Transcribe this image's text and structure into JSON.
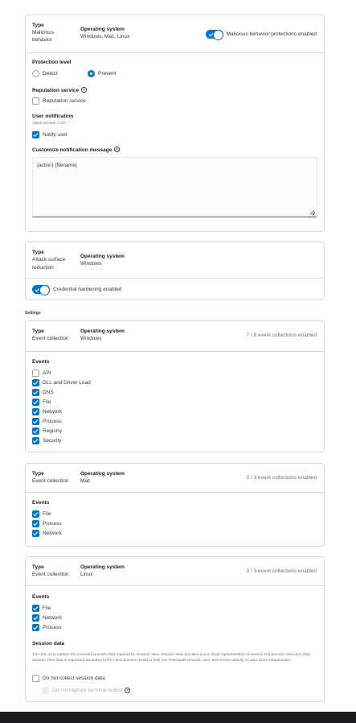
{
  "malicious": {
    "type_label": "Type",
    "type_value_1": "Malicious",
    "type_value_2": "behavior",
    "os_label": "Operating system",
    "os_value": "Windows, Mac, Linux",
    "toggle_label": "Malicious behavior protections enabled",
    "protection_level_label": "Protection level",
    "detect_label": "Detect",
    "prevent_label": "Prevent",
    "reputation_heading": "Reputation service",
    "reputation_checkbox": "Reputation service",
    "user_notification_heading": "User notification",
    "agent_version": "Agent version 7.15+",
    "notify_user_label": "Notify user",
    "customize_heading": "Customize notification message",
    "message_value": "{action} {filename}"
  },
  "attack_surface": {
    "type_label": "Type",
    "type_value_1": "Attack surface",
    "type_value_2": "reduction",
    "os_label": "Operating system",
    "os_value": "Windows",
    "toggle_label": "Credential hardening enabled"
  },
  "settings_label": "Settings",
  "windows_events": {
    "type_label": "Type",
    "type_value": "Event collection",
    "os_label": "Operating system",
    "os_value": "Windows",
    "status": "7 / 8 event collections enabled",
    "events_heading": "Events",
    "items": [
      {
        "label": "API",
        "checked": false
      },
      {
        "label": "DLL and Driver Load",
        "checked": true
      },
      {
        "label": "DNS",
        "checked": true
      },
      {
        "label": "File",
        "checked": true
      },
      {
        "label": "Network",
        "checked": true
      },
      {
        "label": "Process",
        "checked": true
      },
      {
        "label": "Registry",
        "checked": true
      },
      {
        "label": "Security",
        "checked": true
      }
    ]
  },
  "mac_events": {
    "type_label": "Type",
    "type_value": "Event collection",
    "os_label": "Operating system",
    "os_value": "Mac",
    "status": "3 / 3 event collections enabled",
    "events_heading": "Events",
    "items": [
      {
        "label": "File",
        "checked": true
      },
      {
        "label": "Process",
        "checked": true
      },
      {
        "label": "Network",
        "checked": true
      }
    ]
  },
  "linux_events": {
    "type_label": "Type",
    "type_value": "Event collection",
    "os_label": "Operating system",
    "os_value": "Linux",
    "status": "3 / 3 event collections enabled",
    "events_heading": "Events",
    "items": [
      {
        "label": "File",
        "checked": true
      },
      {
        "label": "Network",
        "checked": true
      },
      {
        "label": "Process",
        "checked": true
      }
    ],
    "session_heading": "Session data",
    "session_description": "Turn this on to capture the extended process data required for Session View. Session View provides you a visual representation of session and process execution data. Session View data is organized according to the Linux process model to help you investigate process, user, and service activity on your Linux infrastructure.",
    "no_session_label": "Do not collect session data",
    "no_terminal_label": "Do not capture terminal output"
  },
  "colors": {
    "accent": "#0077cc",
    "border": "#d3dae6",
    "footer": "#1a1c21"
  }
}
